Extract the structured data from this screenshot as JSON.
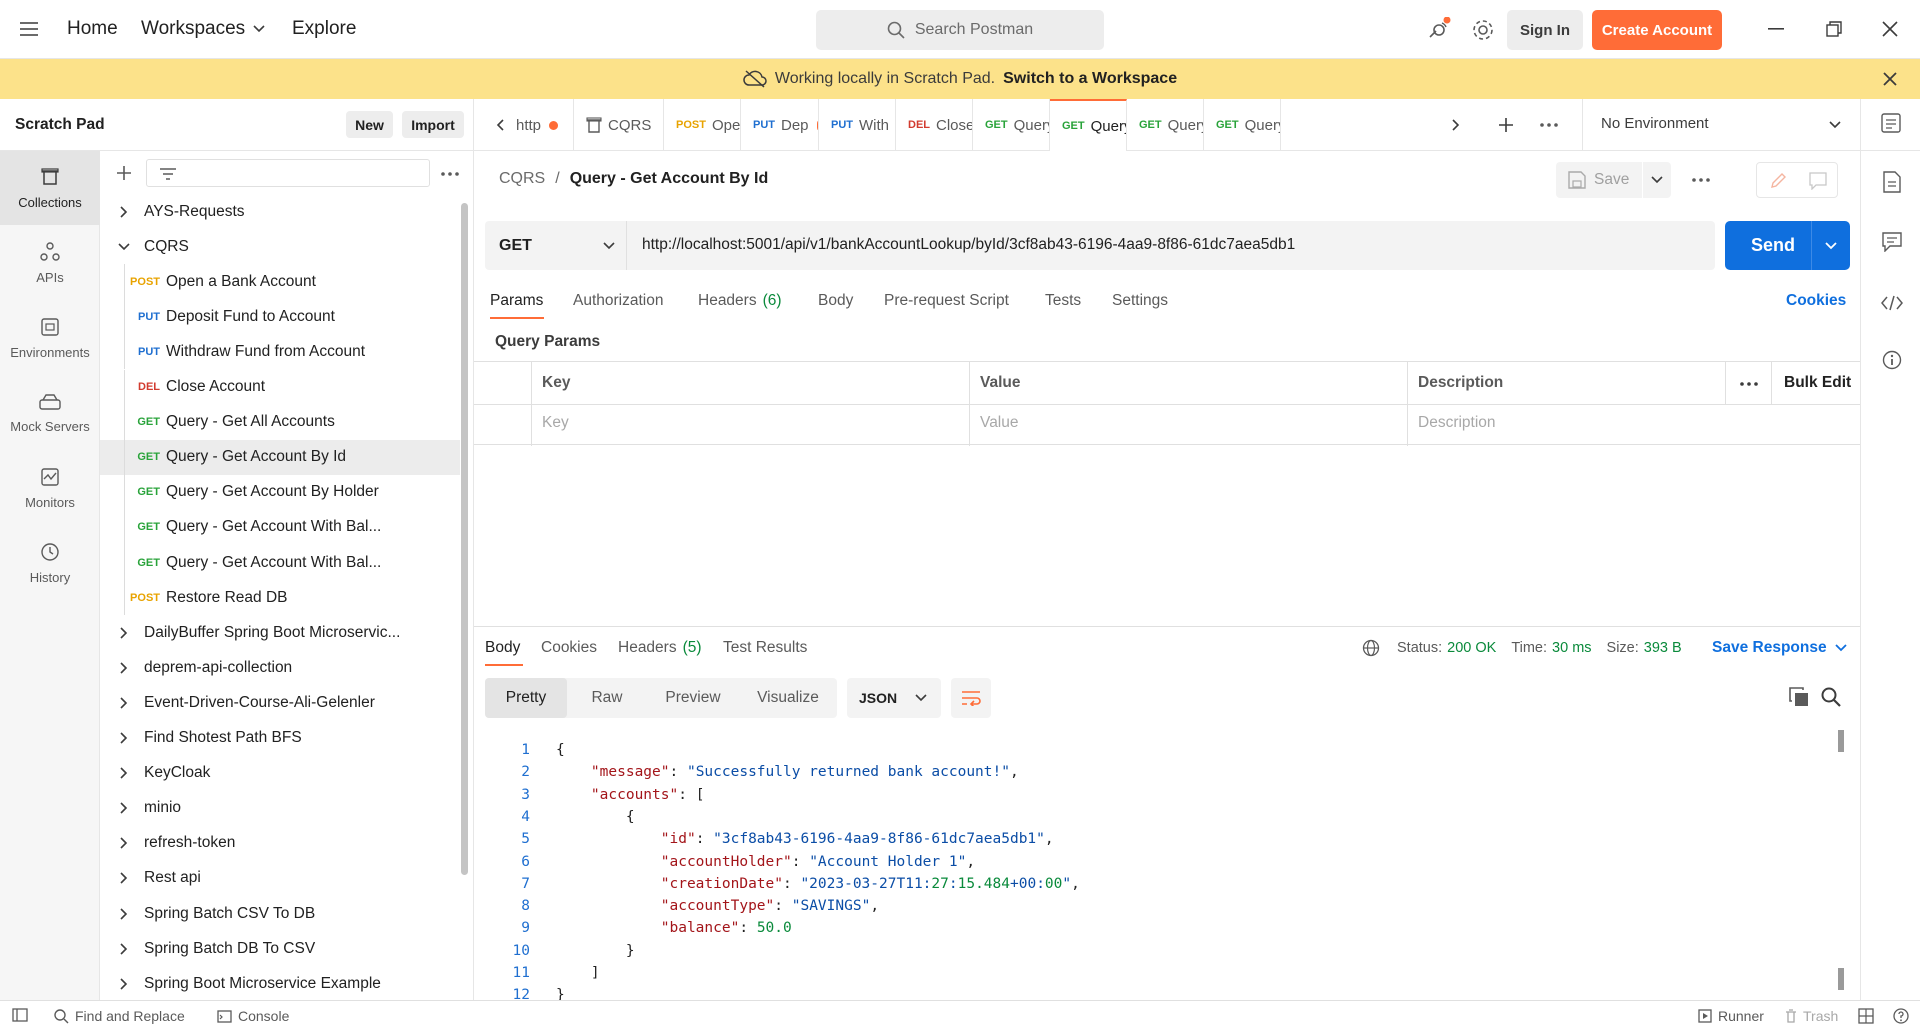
{
  "topbar": {
    "home": "Home",
    "workspaces": "Workspaces",
    "explore": "Explore",
    "search_placeholder": "Search Postman",
    "sign_in": "Sign In",
    "create_account": "Create Account"
  },
  "banner": {
    "text": "Working locally in Scratch Pad.",
    "link": "Switch to a Workspace"
  },
  "scratchpad": {
    "title": "Scratch Pad",
    "new_label": "New",
    "import_label": "Import"
  },
  "iconbar": [
    {
      "label": "Collections",
      "icon": "collections-icon",
      "active": true
    },
    {
      "label": "APIs",
      "icon": "apis-icon"
    },
    {
      "label": "Environments",
      "icon": "environments-icon"
    },
    {
      "label": "Mock Servers",
      "icon": "mock-servers-icon"
    },
    {
      "label": "Monitors",
      "icon": "monitors-icon"
    },
    {
      "label": "History",
      "icon": "history-icon"
    }
  ],
  "tree": [
    {
      "kind": "folder",
      "label": "AYS-Requests",
      "open": false
    },
    {
      "kind": "folder",
      "label": "CQRS",
      "open": true
    },
    {
      "kind": "request",
      "method": "POST",
      "label": "Open a Bank Account"
    },
    {
      "kind": "request",
      "method": "PUT",
      "label": "Deposit Fund to Account"
    },
    {
      "kind": "request",
      "method": "PUT",
      "label": "Withdraw Fund from Account"
    },
    {
      "kind": "request",
      "method": "DEL",
      "label": "Close Account"
    },
    {
      "kind": "request",
      "method": "GET",
      "label": "Query - Get All Accounts"
    },
    {
      "kind": "request",
      "method": "GET",
      "label": "Query - Get Account By Id",
      "selected": true
    },
    {
      "kind": "request",
      "method": "GET",
      "label": "Query - Get Account By Holder"
    },
    {
      "kind": "request",
      "method": "GET",
      "label": "Query - Get Account With Bal..."
    },
    {
      "kind": "request",
      "method": "GET",
      "label": "Query - Get Account With Bal..."
    },
    {
      "kind": "request",
      "method": "POST",
      "label": "Restore Read DB"
    },
    {
      "kind": "folder",
      "label": "DailyBuffer Spring Boot Microservic..."
    },
    {
      "kind": "folder",
      "label": "deprem-api-collection"
    },
    {
      "kind": "folder",
      "label": "Event-Driven-Course-Ali-Gelenler"
    },
    {
      "kind": "folder",
      "label": "Find Shotest Path BFS"
    },
    {
      "kind": "folder",
      "label": "KeyCloak"
    },
    {
      "kind": "folder",
      "label": "minio"
    },
    {
      "kind": "folder",
      "label": "refresh-token"
    },
    {
      "kind": "folder",
      "label": "Rest api"
    },
    {
      "kind": "folder",
      "label": "Spring Batch CSV To DB"
    },
    {
      "kind": "folder",
      "label": "Spring Batch DB To CSV"
    },
    {
      "kind": "folder",
      "label": "Spring Boot Microservice Example"
    }
  ],
  "tabs": [
    {
      "method": "",
      "label": "http",
      "dot": true
    },
    {
      "method": "",
      "label": "CQRS",
      "dot": false,
      "icon": "collection-icon"
    },
    {
      "method": "POST",
      "label": "Open",
      "dot": false
    },
    {
      "method": "PUT",
      "label": "Dep",
      "dot": true
    },
    {
      "method": "PUT",
      "label": "With",
      "dot": true
    },
    {
      "method": "DEL",
      "label": "Close A",
      "dot": false
    },
    {
      "method": "GET",
      "label": "Query",
      "dot": false
    },
    {
      "method": "GET",
      "label": "Query",
      "dot": false,
      "active": true
    },
    {
      "method": "GET",
      "label": "Query",
      "dot": false
    },
    {
      "method": "GET",
      "label": "Query",
      "dot": false
    }
  ],
  "environment": "No Environment",
  "request": {
    "breadcrumb_parent": "CQRS",
    "breadcrumb_sep": "/",
    "title": "Query - Get Account By Id",
    "save_label": "Save",
    "method": "GET",
    "url": "http://localhost:5001/api/v1/bankAccountLookup/byId/3cf8ab43-6196-4aa9-8f86-61dc7aea5db1",
    "send_label": "Send",
    "tabs": {
      "params": "Params",
      "authorization": "Authorization",
      "headers": "Headers",
      "headers_count": "(6)",
      "body": "Body",
      "prerequest": "Pre-request Script",
      "tests": "Tests",
      "settings": "Settings"
    },
    "cookies_label": "Cookies",
    "query_params_title": "Query Params",
    "columns": {
      "key": "Key",
      "value": "Value",
      "description": "Description",
      "bulk_edit": "Bulk Edit"
    },
    "placeholders": {
      "key": "Key",
      "value": "Value",
      "description": "Description"
    }
  },
  "response": {
    "tabs": {
      "body": "Body",
      "cookies": "Cookies",
      "headers": "Headers",
      "headers_count": "(5)",
      "test_results": "Test Results"
    },
    "status_label": "Status:",
    "status_value": "200 OK",
    "time_label": "Time:",
    "time_value": "30 ms",
    "size_label": "Size:",
    "size_value": "393 B",
    "save_response": "Save Response",
    "views": [
      "Pretty",
      "Raw",
      "Preview",
      "Visualize"
    ],
    "format": "JSON",
    "line_numbers": [
      "1",
      "2",
      "3",
      "4",
      "5",
      "6",
      "7",
      "8",
      "9",
      "10",
      "11",
      "12"
    ],
    "code_lines": [
      "{",
      "    \"message\": \"Successfully returned bank account!\",",
      "    \"accounts\": [",
      "        {",
      "            \"id\": \"3cf8ab43-6196-4aa9-8f86-61dc7aea5db1\",",
      "            \"accountHolder\": \"Account Holder 1\",",
      "            \"creationDate\": \"2023-03-27T11:27:15.484+00:00\",",
      "            \"accountType\": \"SAVINGS\",",
      "            \"balance\": 50.0",
      "        }",
      "    ]",
      "}"
    ]
  },
  "statusbar": {
    "find_replace": "Find and Replace",
    "console": "Console",
    "runner": "Runner",
    "trash": "Trash"
  },
  "colors": {
    "accent": "#ff6c37",
    "send": "#0f6fde",
    "banner": "#fce28a",
    "status_ok": "#0a8a3b"
  }
}
